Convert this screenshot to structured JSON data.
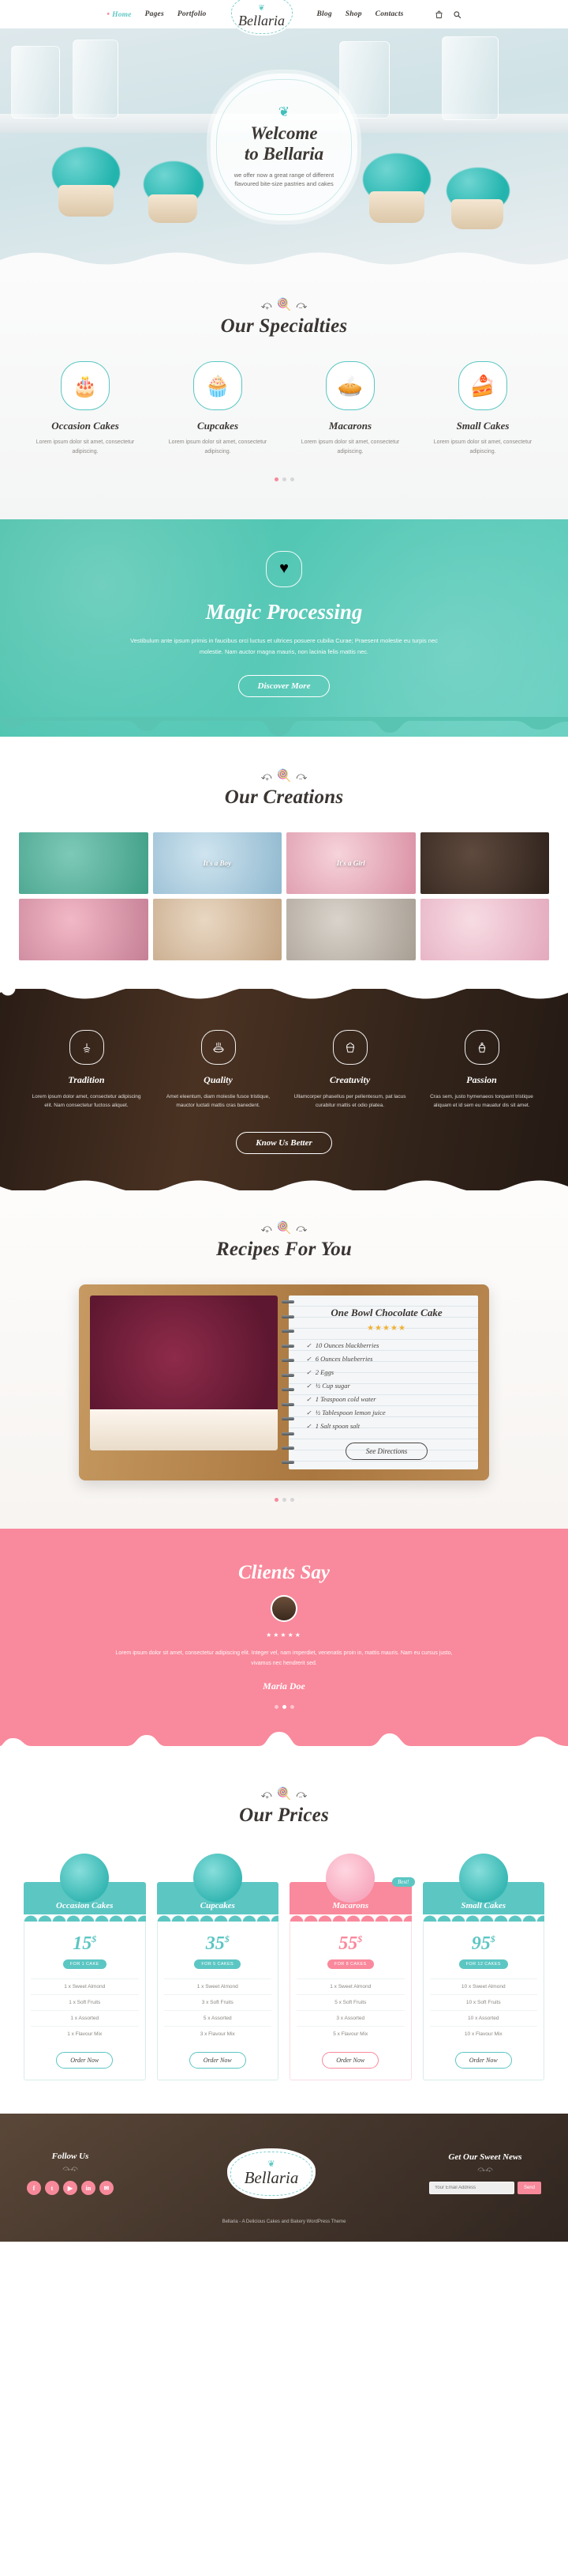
{
  "header": {
    "nav_left": [
      {
        "label": "Home",
        "active": true
      },
      {
        "label": "Pages",
        "active": false
      },
      {
        "label": "Portfolio",
        "active": false
      }
    ],
    "nav_right": [
      {
        "label": "Blog",
        "active": false
      },
      {
        "label": "Shop",
        "active": false
      },
      {
        "label": "Contacts",
        "active": false
      }
    ],
    "logo": {
      "name": "Bellaria",
      "ornament": "❦"
    },
    "icons": [
      {
        "name": "cart-icon"
      },
      {
        "name": "search-icon"
      }
    ]
  },
  "hero": {
    "ornament": "❦",
    "title_line1": "Welcome",
    "title_line2": "to Bellaria",
    "subtitle": "we offer now a great range of different flavoured bite-size pastries and cakes"
  },
  "specialties": {
    "title": "Our Specialties",
    "items": [
      {
        "name": "Occasion Cakes",
        "icon": "cake-icon",
        "glyph": "🎂",
        "desc": "Lorem ipsum dolor sit amet, consectetur adipiscing."
      },
      {
        "name": "Cupcakes",
        "icon": "cupcake-icon",
        "glyph": "🧁",
        "desc": "Lorem ipsum dolor sit amet, consectetur adipiscing."
      },
      {
        "name": "Macarons",
        "icon": "macaron-icon",
        "glyph": "🥧",
        "desc": "Lorem ipsum dolor sit amet, consectetur adipiscing."
      },
      {
        "name": "Small Cakes",
        "icon": "small-cake-icon",
        "glyph": "🍰",
        "desc": "Lorem ipsum dolor sit amet, consectetur adipiscing."
      }
    ],
    "dots": [
      true,
      false,
      false
    ]
  },
  "magic": {
    "badge_icon": "heart-cake-icon",
    "badge_glyph": "♥",
    "title": "Magic Processing",
    "text": "Vestibulum ante ipsum primis in faucibus orci luctus et ultrices posuere cubilia Curae; Praesent molestie eu turpis nec molestie. Nam auctor magna mauris, non lacinia felis mattis nec.",
    "button": "Discover More"
  },
  "creations": {
    "title": "Our Creations",
    "items": [
      {
        "label": "",
        "c1": "#7ec9b8",
        "c2": "#3f9e86"
      },
      {
        "label": "It's a Boy",
        "c1": "#cfe4ef",
        "c2": "#8fb8cf"
      },
      {
        "label": "It's a Girl",
        "c1": "#f6d3da",
        "c2": "#d98fa3"
      },
      {
        "label": "",
        "c1": "#5f4a3e",
        "c2": "#2e221b"
      },
      {
        "label": "",
        "c1": "#f2b8c6",
        "c2": "#c57f95"
      },
      {
        "label": "",
        "c1": "#e9d7c2",
        "c2": "#c2a483"
      },
      {
        "label": "",
        "c1": "#d9d3cb",
        "c2": "#a79e93"
      },
      {
        "label": "",
        "c1": "#f7dce4",
        "c2": "#e3a9bc"
      }
    ]
  },
  "features": {
    "items": [
      {
        "name": "Tradition",
        "icon": "whisk-icon",
        "glyph": "❀",
        "desc": "Lorem ipsum dolor amet, consectetur adipiscing elit. Nam consectetur fuctoss aliquet."
      },
      {
        "name": "Quality",
        "icon": "pie-icon",
        "glyph": "◠",
        "desc": "Amet eleentum, diam molestie fusce tristique, mauctor luctati mattis cras banedent."
      },
      {
        "name": "Creatuvity",
        "icon": "cupcake-outline-icon",
        "glyph": "♣",
        "desc": "Ullamcorper phasellus per pellentesum, pat lacus curabitur mattis et odio platea."
      },
      {
        "name": "Passion",
        "icon": "muffin-icon",
        "glyph": "☘",
        "desc": "Cras sem, justo hymenaeos torquent tristique aliquam et id sem eu mauatur dis sit amet."
      }
    ],
    "button": "Know Us Better"
  },
  "recipes": {
    "title": "Recipes For You",
    "card": {
      "title": "One Bowl Chocolate Cake",
      "stars": "★★★★★",
      "ingredients": [
        "10 Ounces blackberries",
        "6  Ounces blueberries",
        "2  Eggs",
        "½  Cup sugar",
        "1  Teaspoon cold water",
        "½  Tablespoon lemon juice",
        "1  Salt spoon salt"
      ],
      "button": "See Directions"
    },
    "dots": [
      true,
      false,
      false
    ]
  },
  "clients": {
    "title": "Clients Say",
    "stars": "★★★★★",
    "quote": "Lorem ipsum dolor sit amet, consectetur adipiscing elit. Integer vel, nam imperdiet, venenatis proin in, mattis mauris. Nam eu cursus justo, vivamus nec hendrerit sed.",
    "name": "Maria Doe",
    "dots": [
      false,
      true,
      false
    ]
  },
  "prices": {
    "title": "Our Prices",
    "plans": [
      {
        "name": "Occasion Cakes",
        "price": "15",
        "currency": "$",
        "accent": "#5cc6c3",
        "per_label": "FOR 1 CAKE",
        "badge": "",
        "features": [
          "1 x Sweet Almond",
          "1 x Soft Fruits",
          "1 x Assorted",
          "1 x Flavour Mix"
        ],
        "button": "Order Now"
      },
      {
        "name": "Cupcakes",
        "price": "35",
        "currency": "$",
        "accent": "#5cc6c3",
        "per_label": "FOR 5 CAKES",
        "badge": "",
        "features": [
          "1 x Sweet Almond",
          "3 x Soft Fruits",
          "5 x Assorted",
          "3 x Flavour Mix"
        ],
        "button": "Order Now"
      },
      {
        "name": "Macarons",
        "price": "55",
        "currency": "$",
        "accent": "#f9899c",
        "per_label": "FOR 8 CAKES",
        "badge": "Best!",
        "features": [
          "1 x Sweet Almond",
          "5 x Soft Fruits",
          "3 x Assorted",
          "5 x Flavour Mix"
        ],
        "button": "Order Now"
      },
      {
        "name": "Small Cakes",
        "price": "95",
        "currency": "$",
        "accent": "#5cc6c3",
        "per_label": "FOR 12 CAKES",
        "badge": "",
        "features": [
          "10 x Sweet Almond",
          "10 x Soft Fruits",
          "10 x Assorted",
          "10 x Flavour Mix"
        ],
        "button": "Order Now"
      }
    ]
  },
  "footer": {
    "follow_title": "Follow Us",
    "socials": [
      "f",
      "t",
      "▶",
      "in",
      "✉"
    ],
    "logo": {
      "name": "Bellaria",
      "ornament": "❦"
    },
    "news_title": "Get Our Sweet News",
    "news_placeholder": "Your Email Address",
    "news_button": "Send",
    "copyright": "Bellaria - A Delicious Cakes and Bakery WordPress Theme"
  }
}
